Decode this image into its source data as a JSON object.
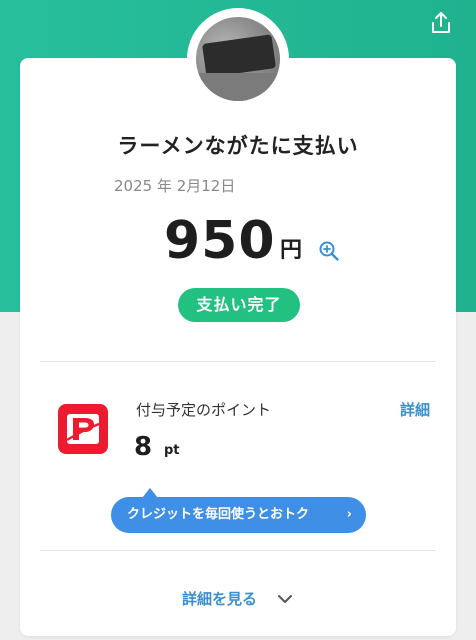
{
  "header": {
    "share_icon": "share-upload-icon"
  },
  "colors": {
    "top_band": "#27bf9c",
    "status_pill": "#22c182",
    "link": "#3b8fd0",
    "promo": "#3f8fe6",
    "paypay_red": "#ee1a30"
  },
  "receipt": {
    "store_name": "ラーメンながたに支払い",
    "date": "2025 年 2月12日",
    "amount": "950",
    "currency": "円",
    "zoom_icon": "zoom-in-icon",
    "status": "支払い完了"
  },
  "points": {
    "label": "付与予定のポイント",
    "detail_label": "詳細",
    "value": "8",
    "unit": "pt",
    "logo_icon": "paypay-logo-icon"
  },
  "promo": {
    "text": "クレジットを毎回使うとおトク",
    "chevron": "›"
  },
  "footer": {
    "see_details_label": "詳細を見る",
    "chevron_icon": "chevron-down-icon"
  }
}
